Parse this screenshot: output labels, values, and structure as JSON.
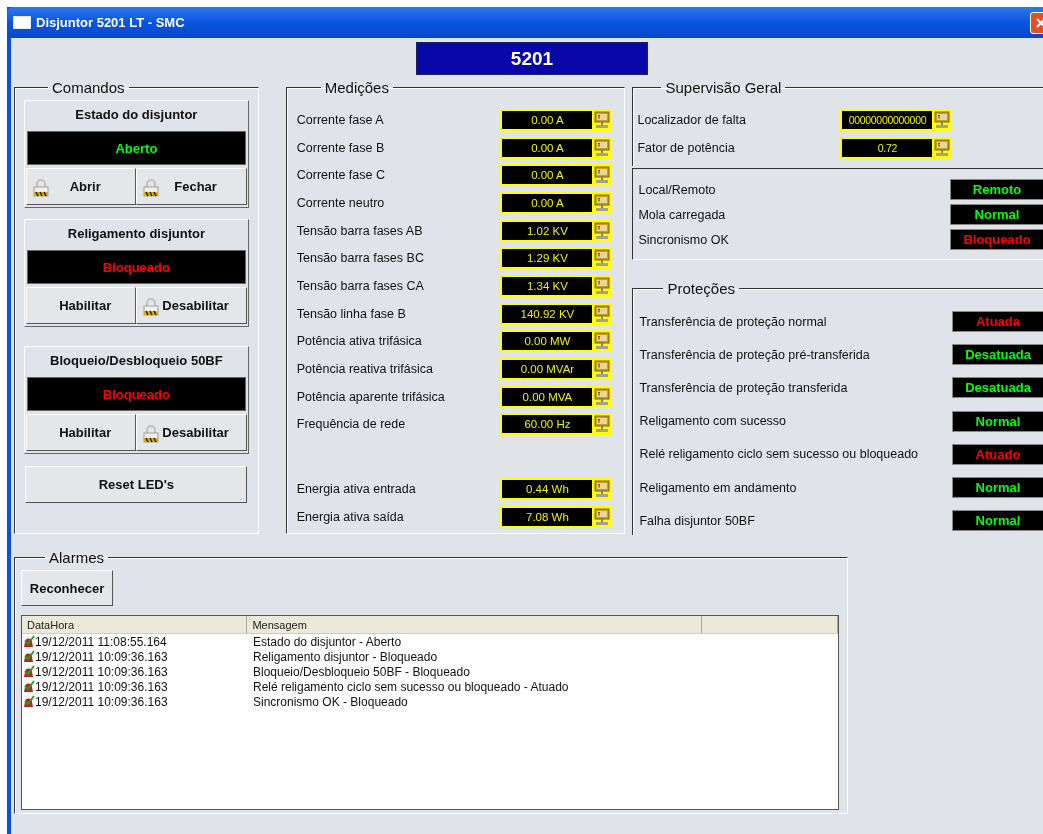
{
  "window": {
    "title": "Disjuntor 5201 LT - SMC"
  },
  "header": {
    "label": "5201"
  },
  "comandos": {
    "title": "Comandos",
    "panels": [
      {
        "title": "Estado do disjuntor",
        "status": "Aberto",
        "alarm": false,
        "buttons": [
          {
            "label": "Abrir",
            "locked": true
          },
          {
            "label": "Fechar",
            "locked": true
          }
        ]
      },
      {
        "title": "Religamento disjuntor",
        "status": "Bloqueado",
        "alarm": true,
        "buttons": [
          {
            "label": "Habilitar",
            "locked": false
          },
          {
            "label": "Desabilitar",
            "locked": true
          }
        ]
      },
      {
        "title": "Bloqueio/Desbloqueio 50BF",
        "status": "Bloqueado",
        "alarm": true,
        "buttons": [
          {
            "label": "Habilitar",
            "locked": false
          },
          {
            "label": "Desabilitar",
            "locked": true
          }
        ]
      }
    ],
    "reset_button": "Reset LED's"
  },
  "medicoes": {
    "title": "Medições",
    "rows": [
      {
        "label": "Corrente fase A",
        "value": "0.00 A"
      },
      {
        "label": "Corrente fase B",
        "value": "0.00 A"
      },
      {
        "label": "Corrente fase C",
        "value": "0.00 A"
      },
      {
        "label": "Corrente neutro",
        "value": "0.00 A"
      },
      {
        "label": "Tensão barra fases AB",
        "value": "1.02 KV"
      },
      {
        "label": "Tensão barra fases BC",
        "value": "1.29 KV"
      },
      {
        "label": "Tensão barra fases CA",
        "value": "1.34 KV"
      },
      {
        "label": "Tensão linha fase B",
        "value": "140.92 KV"
      },
      {
        "label": "Potência ativa trifásica",
        "value": "0.00 MW"
      },
      {
        "label": "Potência reativa trifásica",
        "value": "0.00 MVAr"
      },
      {
        "label": "Potência aparente trifásica",
        "value": "0.00 MVA"
      },
      {
        "label": "Frequência de rede",
        "value": "60.00 Hz"
      }
    ],
    "energy": [
      {
        "label": "Energia ativa entrada",
        "value": "0.44 Wh"
      },
      {
        "label": "Energia ativa saída",
        "value": "7.08 Wh"
      }
    ]
  },
  "supervisao": {
    "title": "Supervisão Geral",
    "readings": [
      {
        "label": "Localizador de falta",
        "value": "00000000000000"
      },
      {
        "label": "Fator de potência",
        "value": "0.72"
      }
    ],
    "statuses": [
      {
        "label": "Local/Remoto",
        "status": "Remoto",
        "alarm": false
      },
      {
        "label": "Mola carregada",
        "status": "Normal",
        "alarm": false
      },
      {
        "label": "Sincronismo OK",
        "status": "Bloqueado",
        "alarm": true
      }
    ]
  },
  "protecoes": {
    "title": "Proteções",
    "statuses": [
      {
        "label": "Transferência de proteção normal",
        "status": "Atuada",
        "alarm": true
      },
      {
        "label": "Transferência de proteção pré-transferida",
        "status": "Desatuada",
        "alarm": false
      },
      {
        "label": "Transferência de proteção transferida",
        "status": "Desatuada",
        "alarm": false
      },
      {
        "label": "Religamento com sucesso",
        "status": "Normal",
        "alarm": false
      },
      {
        "label": "Relé religamento ciclo sem sucesso ou bloqueado",
        "status": "Atuado",
        "alarm": true
      },
      {
        "label": "Religamento em andamento",
        "status": "Normal",
        "alarm": false
      },
      {
        "label": "Falha disjuntor 50BF",
        "status": "Normal",
        "alarm": false
      }
    ]
  },
  "alarmes": {
    "title": "Alarmes",
    "button": "Reconhecer",
    "table": {
      "columns": [
        "DataHora",
        "Mensagem"
      ],
      "rows": [
        {
          "datahora": "19/12/2011 11:08:55.164",
          "mensagem": "Estado do disjuntor - Aberto"
        },
        {
          "datahora": "19/12/2011 10:09:36.163",
          "mensagem": "Religamento disjuntor - Bloqueado"
        },
        {
          "datahora": "19/12/2011 10:09:36.163",
          "mensagem": "Bloqueio/Desbloqueio 50BF - Bloqueado"
        },
        {
          "datahora": "19/12/2011 10:09:36.163",
          "mensagem": "Relé religamento ciclo sem sucesso ou bloqueado - Atuado"
        },
        {
          "datahora": "19/12/2011 10:09:36.163",
          "mensagem": "Sincronismo OK - Bloqueado"
        }
      ]
    }
  }
}
